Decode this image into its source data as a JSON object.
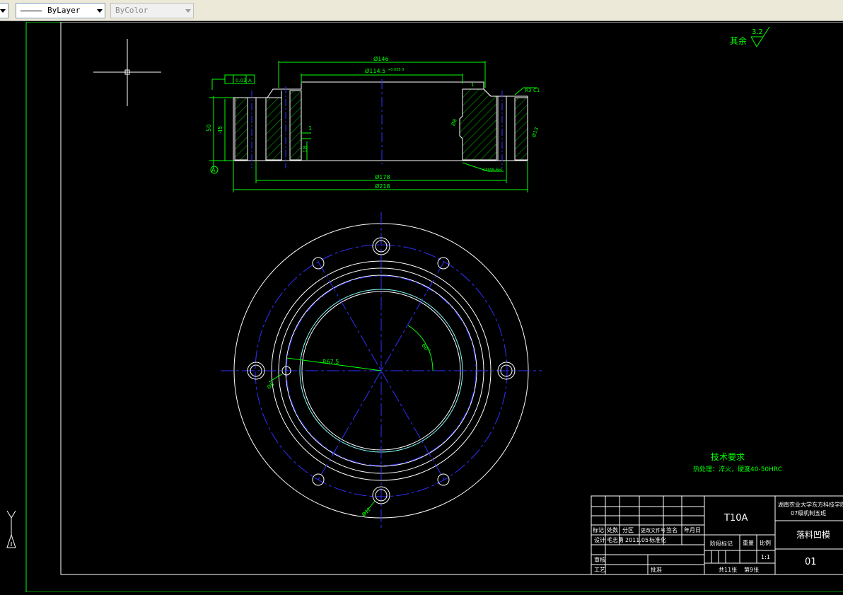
{
  "toolbar": {
    "left_combo_label": "",
    "linetype_value": "ByLayer",
    "color_value": "ByColor"
  },
  "drawing": {
    "roughness_label": "其余",
    "roughness_value": "3.2",
    "tol_flatness": "0.02",
    "tol_datum": "A",
    "datum_label": "A",
    "dim_top_outer": "Ø146",
    "dim_top_inner": "Ø114.5",
    "dim_top_inner_tol": "+0.035 0",
    "dim_bottom_inner": "Ø178",
    "dim_bottom_outer": "Ø218",
    "dim_height_total": "50",
    "dim_height_inner": "45",
    "dim_step_1": "1",
    "dim_step_18": "18",
    "dim_chamfer_r": "R3",
    "dim_chamfer_1": "1",
    "dim_chamfer_2": "C1",
    "dim_bottom_right": "3XM8-6H",
    "dim_side_1": "Ø8",
    "dim_side_2": "Ø13",
    "dim_radius": "R67.5",
    "dim_angle": "60°",
    "dim_hole_left": "Ø8",
    "dim_hole_bottom": "Ø12",
    "tech_title": "技术要求",
    "tech_text": "热处理：淬火，硬度40-50HRC"
  },
  "titleblock": {
    "material": "T10A",
    "school_line1": "湖南农业大学东方科技学院",
    "school_line2": "07级机制五班",
    "part_name": "落料凹模",
    "drawing_no": "01",
    "hdr_mark": "标记",
    "hdr_count": "处数",
    "hdr_zone": "分区",
    "hdr_change_doc": "更改文件号",
    "hdr_sign": "签名",
    "hdr_date": "年月日",
    "row_design": "设计",
    "designer": "毛志勇",
    "design_date": "2011.05",
    "row_standard": "标准化",
    "stage_label": "阶段标记",
    "weight_label": "重量",
    "scale_label": "比例",
    "scale_value": "1:1",
    "review_label": "审核",
    "process_label": "工艺",
    "approve_label": "批准",
    "sheets_total": "共11张",
    "sheet_no": "第9张"
  },
  "ucs": {
    "y_label": "Y"
  }
}
